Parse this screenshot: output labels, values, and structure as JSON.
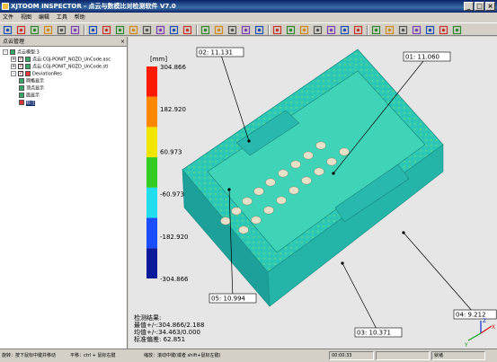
{
  "window": {
    "title": "XJTOOM INSPECTOR  -  点云与数模比对检测软件  V7.0"
  },
  "menu": [
    "文件",
    "视图",
    "编辑",
    "工具",
    "帮助"
  ],
  "toolbar_icons": [
    "new-icon",
    "open-icon",
    "save-icon",
    "import-icon",
    "export-icon",
    "print-icon",
    "refresh-icon",
    "move-icon",
    "zoom-in-icon",
    "zoom-out-icon",
    "zoom-window-icon",
    "rotate-icon",
    "fit-icon",
    "undo-icon",
    "view-front-icon",
    "view-back-icon",
    "view-left-icon",
    "view-right-icon",
    "view-top-icon",
    "select-point-icon",
    "select-rect-icon",
    "select-poly-icon",
    "clip-icon",
    "deselect-icon",
    "cross-section-icon",
    "fit-align-icon",
    "chart-icon",
    "measure-icon",
    "grid-icon",
    "pattern-icon",
    "compare-icon",
    "report-icon",
    "report-save-icon"
  ],
  "panel": {
    "title": "点云管理",
    "tree": [
      {
        "label": "点云模型:3",
        "expander": "-",
        "checkbox": false,
        "icon": "cloud-folder-icon",
        "depth": 0
      },
      {
        "label": "点云:CGJ-PONIT_NOZD_UnCode.asc",
        "expander": "+",
        "checkbox": true,
        "icon": "point-cloud-icon",
        "depth": 1
      },
      {
        "label": "点云:CGJ-PONIT_NOZD_UnCode.stl",
        "expander": "+",
        "checkbox": true,
        "icon": "mesh-icon",
        "depth": 1
      },
      {
        "label": "DeviationRes",
        "expander": "-",
        "checkbox": true,
        "icon": "deviation-icon",
        "depth": 1
      },
      {
        "label": "网格显示",
        "expander": "",
        "checkbox": false,
        "icon": "grid-display-icon",
        "depth": 2
      },
      {
        "label": "顶点显示",
        "expander": "",
        "checkbox": false,
        "icon": "vertex-display-icon",
        "depth": 2
      },
      {
        "label": "面显示",
        "expander": "",
        "checkbox": false,
        "icon": "face-display-icon",
        "depth": 2
      },
      {
        "label": "标注",
        "expander": "",
        "checkbox": false,
        "icon": "annotation-icon",
        "depth": 2,
        "selected": true
      }
    ]
  },
  "legend": {
    "unit": "[mm]",
    "labels": [
      "304.866",
      "182.920",
      "60.973",
      "-60.973",
      "-182.920",
      "-304.866"
    ],
    "colors": [
      "#ff1a00",
      "#ff8800",
      "#f2e600",
      "#33cc22",
      "#22ddee",
      "#1a4dff",
      "#0a1a99"
    ]
  },
  "callouts": [
    {
      "id": "01",
      "text": "01: 11.060"
    },
    {
      "id": "02",
      "text": "02: 11.131"
    },
    {
      "id": "03",
      "text": "03: 10.371"
    },
    {
      "id": "04",
      "text": "04: 9.212"
    },
    {
      "id": "05",
      "text": "05: 10.994"
    }
  ],
  "results": {
    "heading": "检测结果:",
    "max": "最值+/-:304.866/2.188",
    "mean": "均值+/-:34.463/0.000",
    "stddev": "标准偏差: 62.851"
  },
  "axes": {
    "x": "X",
    "y": "Y",
    "z": "Z"
  },
  "status": {
    "rotate": "旋转：按下鼠标中键并移动",
    "pan": "平移：ctrl + 鼠标右键",
    "zoom": "缩放：滚动中键(或者 shift+鼠标左键)",
    "time": "00:00:33",
    "right": "就绪"
  }
}
